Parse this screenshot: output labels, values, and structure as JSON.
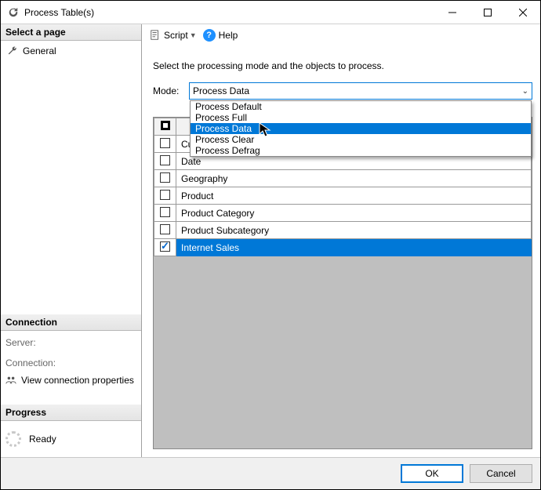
{
  "window": {
    "title": "Process Table(s)"
  },
  "sidebar": {
    "select_page_header": "Select a page",
    "pages": [
      {
        "label": "General"
      }
    ],
    "connection_header": "Connection",
    "server_label": "Server:",
    "server_value": "",
    "connection_label": "Connection:",
    "connection_value": "",
    "view_conn_props": "View connection properties",
    "progress_header": "Progress",
    "progress_status": "Ready"
  },
  "toolbar": {
    "script_label": "Script",
    "help_label": "Help"
  },
  "main": {
    "instruction": "Select the processing mode and the objects to process.",
    "mode_label": "Mode:",
    "mode_value": "Process Data",
    "mode_options": [
      "Process Default",
      "Process Full",
      "Process Data",
      "Process Clear",
      "Process Defrag"
    ],
    "mode_selected_index": 2,
    "table_header": "",
    "rows": [
      {
        "label": "Customer",
        "checked": false
      },
      {
        "label": "Date",
        "checked": false
      },
      {
        "label": "Geography",
        "checked": false
      },
      {
        "label": "Product",
        "checked": false
      },
      {
        "label": "Product Category",
        "checked": false
      },
      {
        "label": "Product Subcategory",
        "checked": false
      },
      {
        "label": "Internet Sales",
        "checked": true
      }
    ]
  },
  "footer": {
    "ok": "OK",
    "cancel": "Cancel"
  }
}
